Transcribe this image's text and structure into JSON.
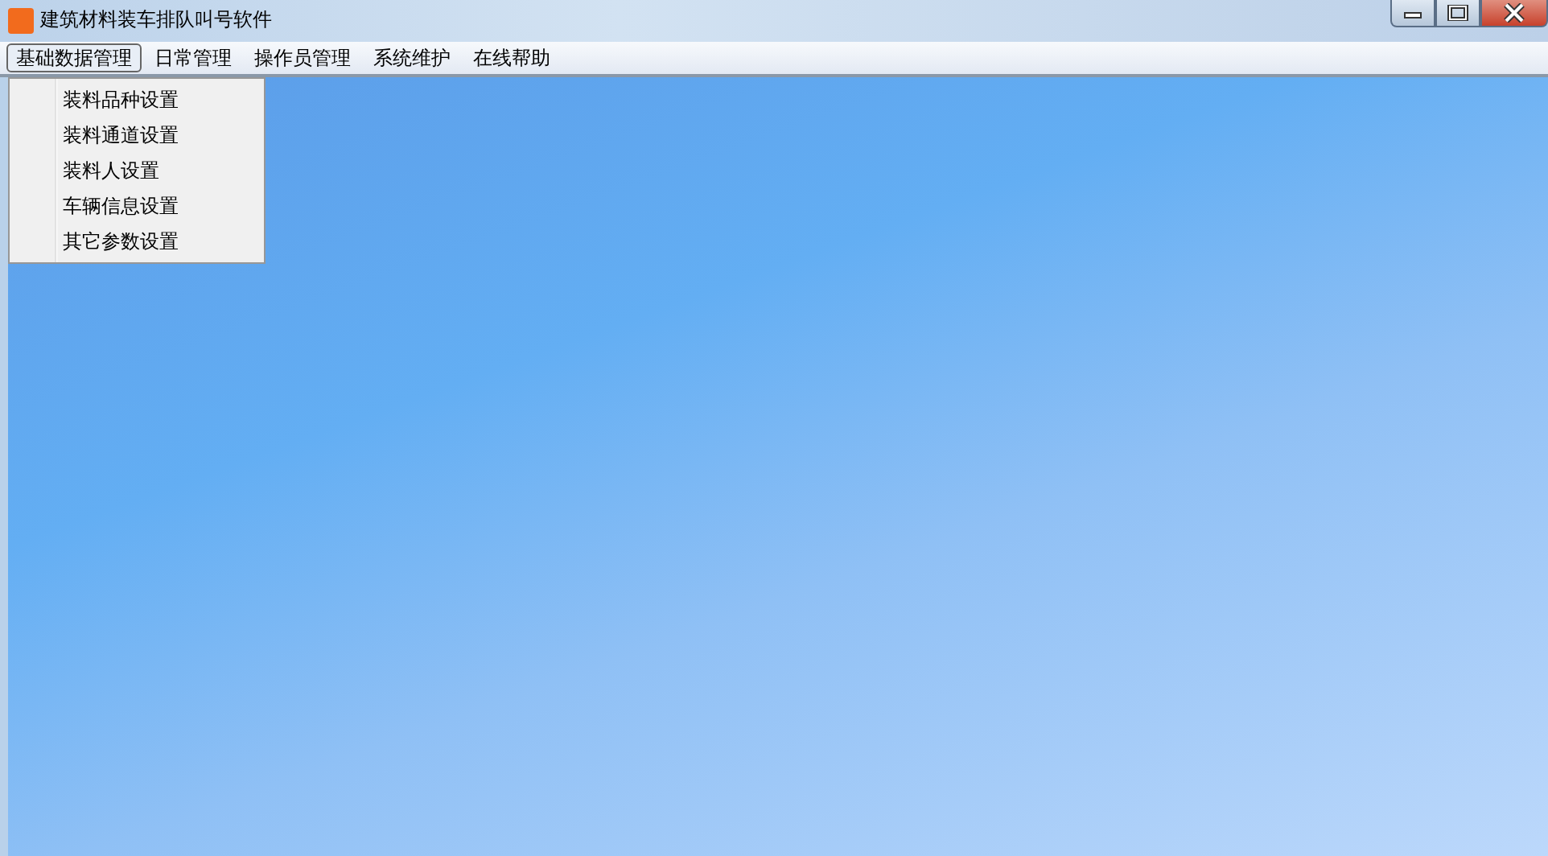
{
  "window": {
    "title": "建筑材料装车排队叫号软件"
  },
  "menu": [
    {
      "label": "基础数据管理",
      "selected": true
    },
    {
      "label": "日常管理",
      "selected": false
    },
    {
      "label": "操作员管理",
      "selected": false
    },
    {
      "label": "系统维护",
      "selected": false
    },
    {
      "label": "在线帮助",
      "selected": false
    }
  ],
  "dropdown": {
    "items": [
      "装料品种设置",
      "装料通道设置",
      "装料人设置",
      "车辆信息设置",
      "其它参数设置"
    ]
  }
}
